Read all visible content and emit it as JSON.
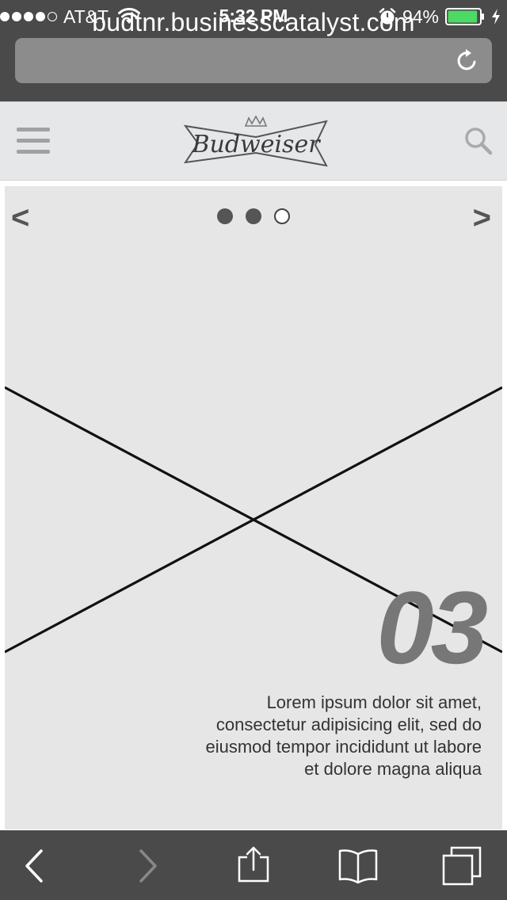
{
  "status_bar": {
    "carrier": "AT&T",
    "time": "5:32 PM",
    "battery_percent": "94%",
    "battery_level": 0.94,
    "signal_bars": 4,
    "signal_total": 5,
    "icons": [
      "wifi-icon",
      "alarm-icon",
      "battery-icon",
      "charging-icon"
    ]
  },
  "browser": {
    "url": "budtnr.businesscatalyst.com",
    "reload_icon": "reload-icon",
    "toolbar": {
      "icons": [
        "back-icon",
        "forward-icon",
        "share-icon",
        "bookmarks-icon",
        "tabs-icon"
      ]
    }
  },
  "site_header": {
    "menu_icon": "hamburger-icon",
    "logo_text": "Budweiser",
    "search_icon": "search-icon"
  },
  "slider": {
    "prev_label": "<",
    "next_label": ">",
    "dot_count": 3,
    "active_index": 2,
    "slide_number": "03",
    "caption_lines": [
      "Lorem ipsum dolor sit amet,",
      "consectetur adipisicing elit, sed do",
      "eiusmod tempor incididunt ut labore",
      "et dolore magna aliqua"
    ]
  },
  "colors": {
    "chrome": "#4a4a4a",
    "header_bg": "#e6e7e8",
    "slide_bg": "#e6e6e6",
    "battery_fill": "#4cd964"
  }
}
